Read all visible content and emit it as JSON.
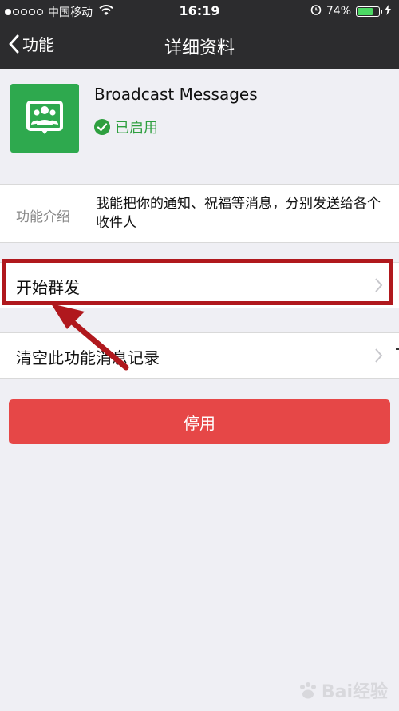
{
  "status_bar": {
    "carrier": "中国移动",
    "time": "16:19",
    "battery_percent": "74%",
    "battery_level": 0.74,
    "signal_bars": 1
  },
  "nav": {
    "back_label": "功能",
    "title": "详细资料"
  },
  "profile": {
    "app_name": "Broadcast Messages",
    "status": "已启用",
    "icon_color": "#2ea94e"
  },
  "intro": {
    "label": "功能介绍",
    "text": "我能把你的通知、祝福等消息，分别发送给各个收件人"
  },
  "cells": {
    "start_group_send": "开始群发",
    "clear_history": "清空此功能消息记录"
  },
  "actions": {
    "disable_label": "停用",
    "disable_color": "#e64747"
  },
  "annotation": {
    "highlight_color": "#b0181d"
  },
  "watermark": {
    "text": "Bai经验"
  }
}
